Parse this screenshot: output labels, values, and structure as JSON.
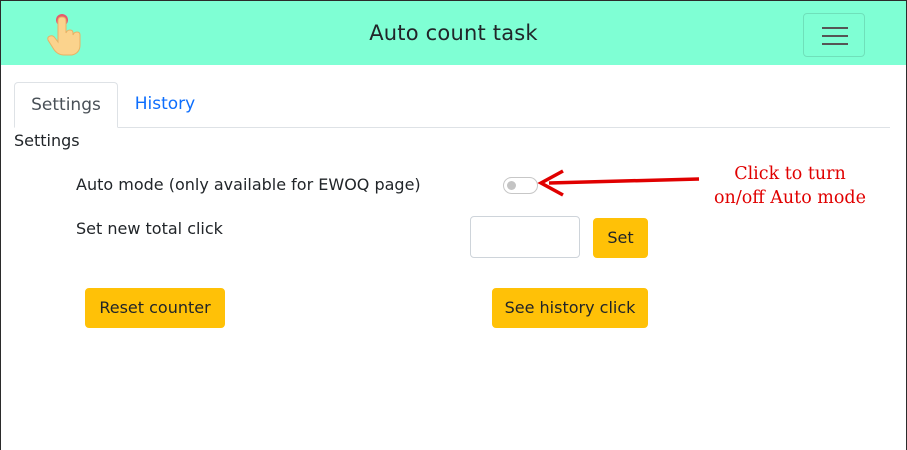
{
  "header": {
    "title": "Auto count task",
    "logo_icon": "pointing-hand-icon",
    "menu_icon": "hamburger-menu-icon"
  },
  "tabs": [
    {
      "label": "Settings",
      "active": true
    },
    {
      "label": "History",
      "active": false
    }
  ],
  "settings": {
    "section_title": "Settings",
    "auto_mode_label": "Auto mode (only available for EWOQ page)",
    "auto_mode_enabled": false,
    "total_click_label": "Set new total click",
    "total_click_value": "",
    "set_button": "Set",
    "reset_button": "Reset counter",
    "history_button": "See history click"
  },
  "annotation": {
    "line1": "Click to turn",
    "line2": "on/off Auto mode",
    "color": "#e00000"
  },
  "colors": {
    "navbar": "#7fffd4",
    "button": "#ffc107",
    "link": "#0d6efd"
  }
}
